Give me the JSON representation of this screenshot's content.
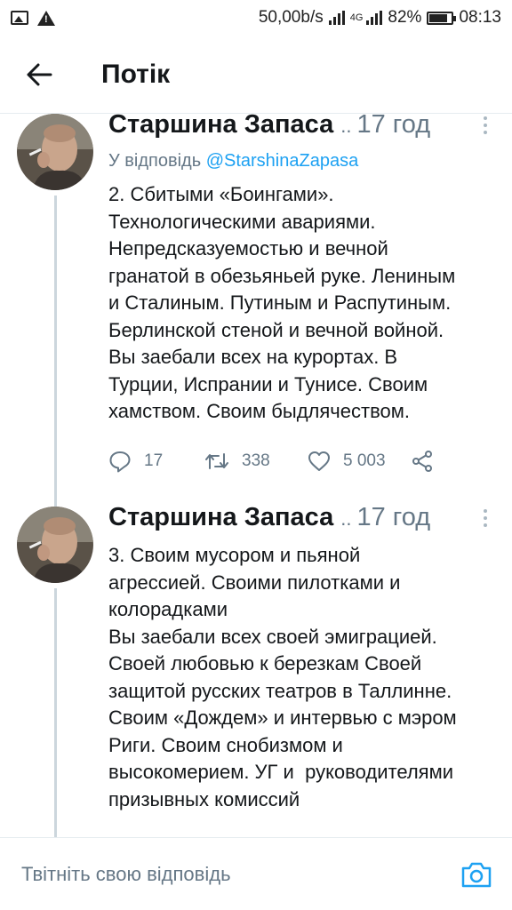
{
  "status_bar": {
    "net_speed": "50,00b/s",
    "network_type": "4G",
    "battery_percent": "82%",
    "battery_level": 0.82,
    "time": "08:13",
    "icons": [
      "image-icon",
      "warning-icon",
      "signal-icon",
      "battery-icon"
    ]
  },
  "header": {
    "back_icon": "arrow-left-icon",
    "title": "Потік"
  },
  "tweets": [
    {
      "author": "Старшина Запаса",
      "truncation": "..",
      "time": "17 год",
      "reply_prefix": "У відповідь",
      "reply_handle": "@StarshinaZapasa",
      "text": "2. Сбитыми «Боингами».\nТехнологическими авариями.\nНепредсказуемостью и вечной\nгранатой в обезьяньей руке. Лениным\nи Сталиным. Путиным и Распутиным.\nБерлинской стеной и вечной войной.\nВы заебали всех на курортах. В\nТурции, Испрании и Тунисе. Своим\nхамством. Своим быдлячеством.",
      "replies": "17",
      "retweets": "338",
      "likes": "5 003"
    },
    {
      "author": "Старшина Запаса",
      "truncation": "..",
      "time": "17 год",
      "text": "3. Своим мусором и пьяной\nагрессией. Своими пилотками и\nколорадками\nВы заебали всех своей эмиграцией.\nСвоей любовью к березкам Своей\nзащитой русских театров в Таллинне.\nСвоим «Дождем» и интервью с мэром\nРиги. Своим снобизмом и\nвысокомерием. УГ и  руководителями\nпризывных комиссий"
    }
  ],
  "reply_bar": {
    "placeholder": "Твітніть свою відповідь",
    "camera_icon": "camera-icon"
  },
  "colors": {
    "accent": "#1da1f2",
    "text": "#14171a",
    "secondary": "#657786",
    "divider": "#e6ecf0"
  }
}
